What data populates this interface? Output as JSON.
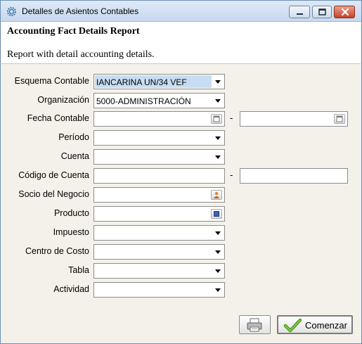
{
  "window": {
    "title": "Detalles de Asientos Contables",
    "icon": "gear-icon"
  },
  "header": {
    "report_title": "Accounting Fact Details Report",
    "report_description": "Report with detail accounting details."
  },
  "form": {
    "accounting_schema": {
      "label": "Esquema Contable",
      "value": "IANCARINA UN/34 VEF"
    },
    "organization": {
      "label": "Organización",
      "value": "5000-ADMINISTRACIÓN"
    },
    "accounting_date": {
      "label": "Fecha Contable",
      "from": "",
      "to": "",
      "separator": "-"
    },
    "period": {
      "label": "Período",
      "value": ""
    },
    "account": {
      "label": "Cuenta",
      "value": ""
    },
    "account_code": {
      "label": "Código de Cuenta",
      "from": "",
      "to": "",
      "separator": "-"
    },
    "business_partner": {
      "label": "Socio del Negocio",
      "value": ""
    },
    "product": {
      "label": "Producto",
      "value": ""
    },
    "tax": {
      "label": "Impuesto",
      "value": ""
    },
    "cost_center": {
      "label": "Centro de Costo",
      "value": ""
    },
    "table": {
      "label": "Tabla",
      "value": ""
    },
    "activity": {
      "label": "Actividad",
      "value": ""
    }
  },
  "footer": {
    "start_label": "Comenzar",
    "print_icon": "printer-icon",
    "start_icon": "checkmark-icon"
  },
  "colors": {
    "selection": "#c8ddf3",
    "panel_background": "#f4f1ea",
    "checkmark": "#4e9a1f"
  }
}
